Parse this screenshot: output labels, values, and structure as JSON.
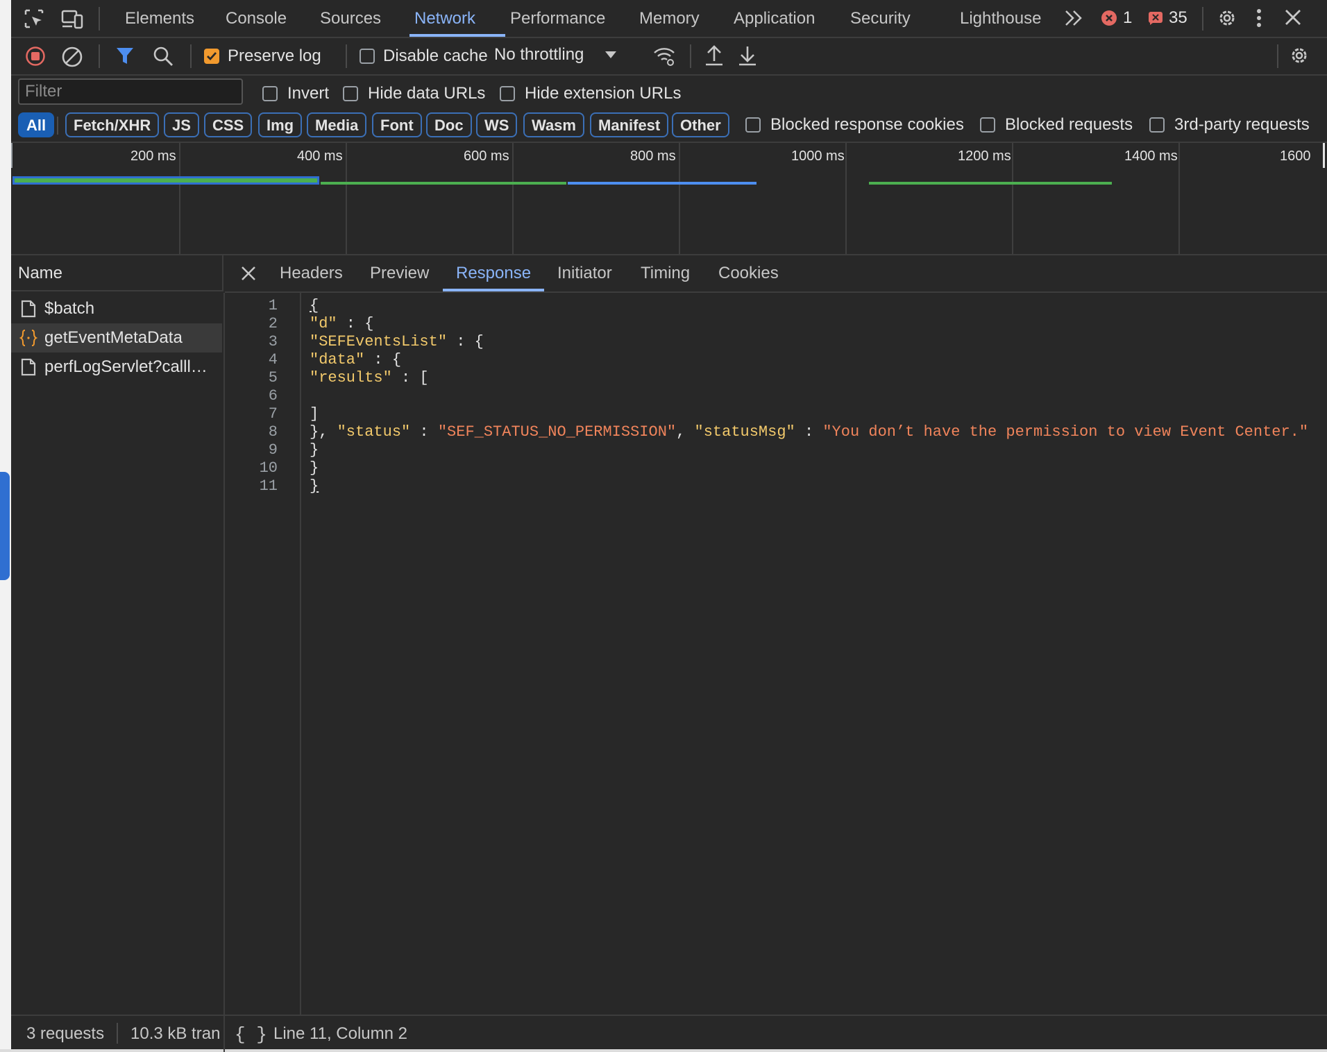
{
  "devtools": {
    "tabs": [
      "Elements",
      "Console",
      "Sources",
      "Network",
      "Performance",
      "Memory",
      "Application",
      "Security",
      "Lighthouse"
    ],
    "active_tab": "Network",
    "error_count": "1",
    "issue_count": "35",
    "colors": {
      "accent": "#8ab4f8",
      "error": "#e46962",
      "chip_active": "#1a5fb4"
    }
  },
  "toolbar": {
    "preserve_log_label": "Preserve log",
    "preserve_log_checked": true,
    "disable_cache_label": "Disable cache",
    "disable_cache_checked": false,
    "throttling_value": "No throttling"
  },
  "filter": {
    "placeholder": "Filter",
    "invert_label": "Invert",
    "hide_data_urls_label": "Hide data URLs",
    "hide_extension_urls_label": "Hide extension URLs",
    "types": [
      "All",
      "Fetch/XHR",
      "JS",
      "CSS",
      "Img",
      "Media",
      "Font",
      "Doc",
      "WS",
      "Wasm",
      "Manifest",
      "Other"
    ],
    "active_type": "All",
    "blocked_response_cookies_label": "Blocked response cookies",
    "blocked_requests_label": "Blocked requests",
    "third_party_label": "3rd-party requests"
  },
  "overview": {
    "ticks": [
      "200 ms",
      "400 ms",
      "600 ms",
      "800 ms",
      "1000 ms",
      "1200 ms",
      "1400 ms",
      "1600"
    ]
  },
  "requests": {
    "column_name": "Name",
    "items": [
      {
        "name": "$batch",
        "icon": "document-icon"
      },
      {
        "name": "getEventMetaData",
        "icon": "json-icon"
      },
      {
        "name": "perfLogServlet?calll…",
        "icon": "document-icon"
      }
    ],
    "selected_index": 1
  },
  "detail": {
    "tabs": [
      "Headers",
      "Preview",
      "Response",
      "Initiator",
      "Timing",
      "Cookies"
    ],
    "active_tab": "Response"
  },
  "response": {
    "line_numbers": [
      "1",
      "2",
      "3",
      "4",
      "5",
      "6",
      "7",
      "8",
      "9",
      "10",
      "11"
    ],
    "lines": [
      "{",
      "\"d\" : {",
      "\"SEFEventsList\" : {",
      "\"data\" : {",
      "\"results\" : [",
      "",
      "]",
      "}, \"status\" : \"SEF_STATUS_NO_PERMISSION\", \"statusMsg\" : \"You don’t have the permission to view Event Center.\"",
      "}",
      "}",
      "}"
    ],
    "tokens": {
      "k_d": "\"d\"",
      "k_sef": "\"SEFEventsList\"",
      "k_data": "\"data\"",
      "k_results": "\"results\"",
      "k_status": "\"status\"",
      "v_status": "\"SEF_STATUS_NO_PERMISSION\"",
      "k_statusmsg": "\"statusMsg\"",
      "v_statusmsg": "\"You don’t have the permission to view Event Center.\""
    }
  },
  "status": {
    "requests": "3 requests",
    "transferred": "10.3 kB tran",
    "cursor": "Line 11, Column 2"
  }
}
